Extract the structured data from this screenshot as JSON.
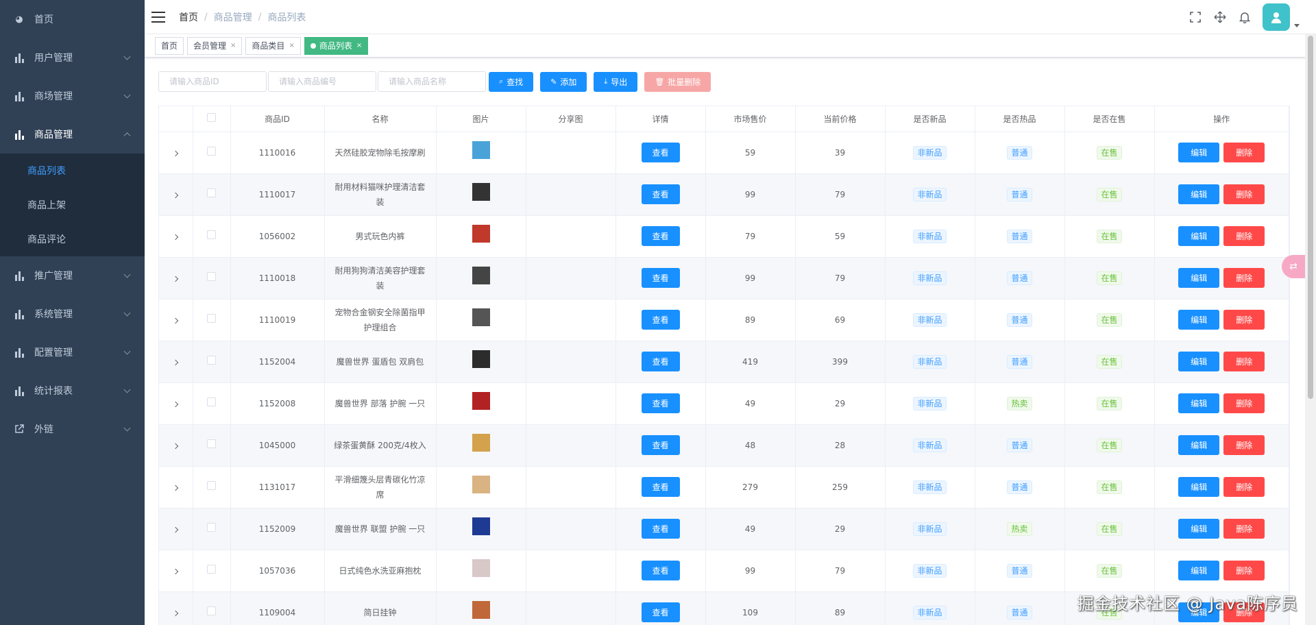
{
  "sidebar": {
    "items": [
      {
        "label": "首页"
      },
      {
        "label": "用户管理"
      },
      {
        "label": "商场管理"
      },
      {
        "label": "商品管理"
      },
      {
        "label": "推广管理"
      },
      {
        "label": "系统管理"
      },
      {
        "label": "配置管理"
      },
      {
        "label": "统计报表"
      },
      {
        "label": "外链"
      }
    ],
    "submenu": [
      {
        "label": "商品列表"
      },
      {
        "label": "商品上架"
      },
      {
        "label": "商品评论"
      }
    ]
  },
  "breadcrumb": [
    "首页",
    "商品管理",
    "商品列表"
  ],
  "tags": [
    {
      "label": "首页"
    },
    {
      "label": "会员管理"
    },
    {
      "label": "商品类目"
    },
    {
      "label": "商品列表"
    }
  ],
  "search": {
    "id_placeholder": "请输入商品ID",
    "sn_placeholder": "请输入商品编号",
    "name_placeholder": "请输入商品名称",
    "find_label": "查找",
    "add_label": "添加",
    "export_label": "导出",
    "batch_delete_label": "批量删除"
  },
  "table": {
    "headers": [
      "商品ID",
      "名称",
      "图片",
      "分享图",
      "详情",
      "市场售价",
      "当前价格",
      "是否新品",
      "是否热品",
      "是否在售",
      "操作"
    ],
    "view_label": "查看",
    "edit_label": "编辑",
    "delete_label": "删除",
    "rows": [
      {
        "id": "1110016",
        "name": "天然硅胶宠物除毛按摩刷",
        "market": "59",
        "price": "39",
        "isNew": "非新品",
        "isHot": "普通",
        "onSale": "在售",
        "thumb": "#4aa3d8"
      },
      {
        "id": "1110017",
        "name": "耐用材料猫咪护理清洁套装",
        "market": "99",
        "price": "79",
        "isNew": "非新品",
        "isHot": "普通",
        "onSale": "在售",
        "thumb": "#333333"
      },
      {
        "id": "1056002",
        "name": "男式玩色内裤",
        "market": "79",
        "price": "59",
        "isNew": "非新品",
        "isHot": "普通",
        "onSale": "在售",
        "thumb": "#c0392b"
      },
      {
        "id": "1110018",
        "name": "耐用狗狗清洁美容护理套装",
        "market": "99",
        "price": "79",
        "isNew": "非新品",
        "isHot": "普通",
        "onSale": "在售",
        "thumb": "#444444"
      },
      {
        "id": "1110019",
        "name": "宠物合金钢安全除菌指甲护理组合",
        "market": "89",
        "price": "69",
        "isNew": "非新品",
        "isHot": "普通",
        "onSale": "在售",
        "thumb": "#555555"
      },
      {
        "id": "1152004",
        "name": "魔兽世界 蛋盾包 双肩包",
        "market": "419",
        "price": "399",
        "isNew": "非新品",
        "isHot": "普通",
        "onSale": "在售",
        "thumb": "#2c2c2c"
      },
      {
        "id": "1152008",
        "name": "魔兽世界 部落 护腕 一只",
        "market": "49",
        "price": "29",
        "isNew": "非新品",
        "isHot": "热卖",
        "onSale": "在售",
        "thumb": "#b22222"
      },
      {
        "id": "1045000",
        "name": "绿茶蛋黄酥 200克/4枚入",
        "market": "48",
        "price": "28",
        "isNew": "非新品",
        "isHot": "普通",
        "onSale": "在售",
        "thumb": "#d4a24c"
      },
      {
        "id": "1131017",
        "name": "平滑细篾头层青碳化竹凉席",
        "market": "279",
        "price": "259",
        "isNew": "非新品",
        "isHot": "普通",
        "onSale": "在售",
        "thumb": "#d9b382"
      },
      {
        "id": "1152009",
        "name": "魔兽世界 联盟 护腕 一只",
        "market": "49",
        "price": "29",
        "isNew": "非新品",
        "isHot": "热卖",
        "onSale": "在售",
        "thumb": "#1f3a93"
      },
      {
        "id": "1057036",
        "name": "日式纯色水洗亚麻抱枕",
        "market": "99",
        "price": "79",
        "isNew": "非新品",
        "isHot": "普通",
        "onSale": "在售",
        "thumb": "#d8c8c8"
      },
      {
        "id": "1109004",
        "name": "简日挂钟",
        "market": "109",
        "price": "89",
        "isNew": "非新品",
        "isHot": "普通",
        "onSale": "在售",
        "thumb": "#c0683a"
      }
    ]
  },
  "watermark": "掘金技术社区 @ Java陈序员"
}
